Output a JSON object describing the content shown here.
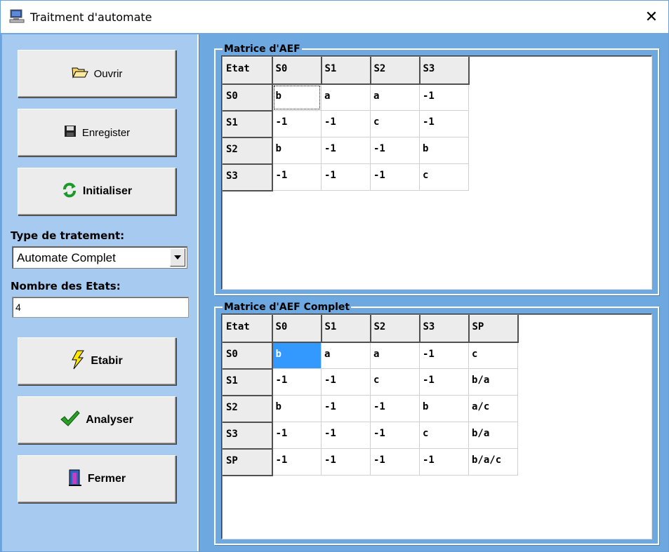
{
  "window": {
    "title": "Traitment d'automate",
    "close_glyph": "✕"
  },
  "buttons": {
    "ouvrir": "Ouvrir",
    "enregistrer": "Enregister",
    "initialiser": "Initialiser",
    "etabir": "Etabir",
    "analyser": "Analyser",
    "fermer": "Fermer"
  },
  "form": {
    "type_label": "Type de tratement:",
    "type_value": "Automate Complet",
    "nombre_label": "Nombre  des Etats:",
    "nombre_value": "4"
  },
  "matrice": {
    "title": "Matrice d'AEF",
    "headers": [
      "Etat",
      "S0",
      "S1",
      "S2",
      "S3"
    ],
    "rows": [
      [
        "S0",
        "b",
        "a",
        "a",
        "-1"
      ],
      [
        "S1",
        "-1",
        "-1",
        "c",
        "-1"
      ],
      [
        "S2",
        "b",
        "-1",
        "-1",
        "b"
      ],
      [
        "S3",
        "-1",
        "-1",
        "-1",
        "c"
      ]
    ]
  },
  "matrice_complet": {
    "title": "Matrice d'AEF Complet",
    "headers": [
      "Etat",
      "S0",
      "S1",
      "S2",
      "S3",
      "SP"
    ],
    "rows": [
      [
        "S0",
        "b",
        "a",
        "a",
        "-1",
        "c"
      ],
      [
        "S1",
        "-1",
        "-1",
        "c",
        "-1",
        "b/a"
      ],
      [
        "S2",
        "b",
        "-1",
        "-1",
        "b",
        "a/c"
      ],
      [
        "S3",
        "-1",
        "-1",
        "-1",
        "c",
        "b/a"
      ],
      [
        "SP",
        "-1",
        "-1",
        "-1",
        "-1",
        "b/a/c"
      ]
    ]
  },
  "icons": [
    "app-icon",
    "folder-open-icon",
    "floppy-disk-icon",
    "refresh-icon",
    "lightning-icon",
    "checkmark-icon",
    "door-exit-icon",
    "chevron-down-icon",
    "close-icon"
  ]
}
